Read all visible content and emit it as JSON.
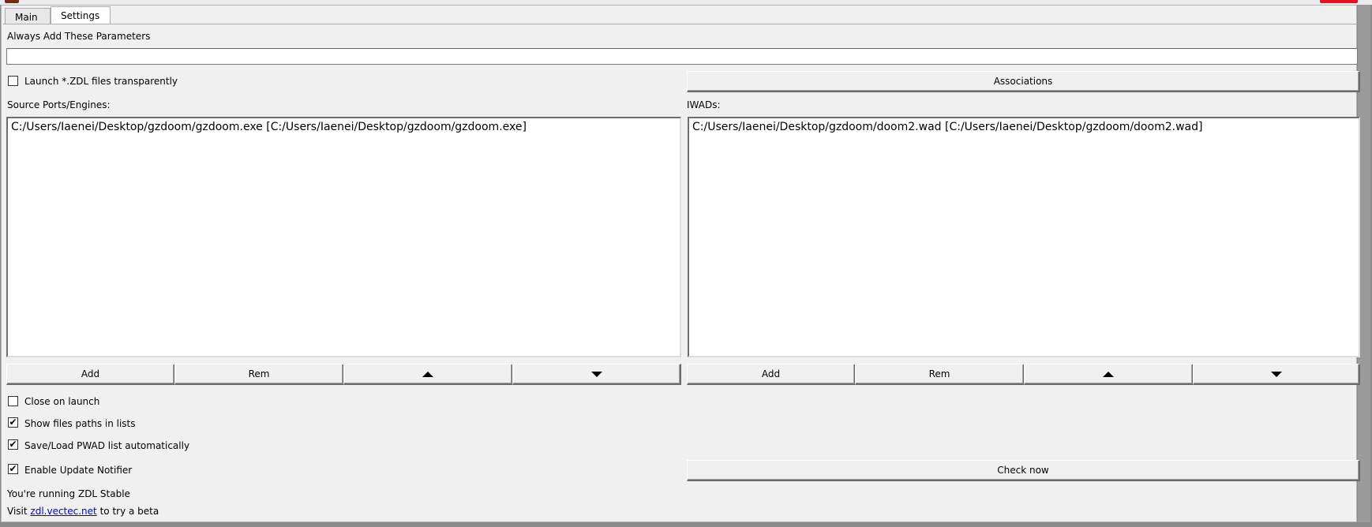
{
  "tabs": [
    {
      "label": "Main"
    },
    {
      "label": "Settings"
    }
  ],
  "settings": {
    "always_add_label": "Always Add These Parameters",
    "always_add_value": "",
    "launch_zdl_label": "Launch *.ZDL files transparently",
    "launch_zdl_checked": false,
    "associations_button": "Associations",
    "source_ports_label": "Source Ports/Engines:",
    "iwads_label": "IWADs:",
    "source_ports": [
      "C:/Users/Iaenei/Desktop/gzdoom/gzdoom.exe [C:/Users/Iaenei/Desktop/gzdoom/gzdoom.exe]"
    ],
    "iwads": [
      "C:/Users/Iaenei/Desktop/gzdoom/doom2.wad [C:/Users/Iaenei/Desktop/gzdoom/doom2.wad]"
    ],
    "add_label": "Add",
    "rem_label": "Rem",
    "up_icon": "triangle-up-icon",
    "down_icon": "triangle-down-icon",
    "close_on_launch_label": "Close on launch",
    "close_on_launch_checked": false,
    "show_paths_label": "Show files paths in lists",
    "show_paths_checked": true,
    "save_load_label": "Save/Load PWAD list automatically",
    "save_load_checked": true,
    "update_notifier_label": "Enable Update Notifier",
    "update_notifier_checked": true,
    "check_now_button": "Check now",
    "running_text": "You're running ZDL Stable",
    "visit_prefix": "Visit",
    "visit_link": "zdl.vectec.net",
    "visit_suffix": "to try a beta",
    "check_mark": "✔"
  },
  "colors": {
    "window_bg": "#f0f0f0",
    "close_button": "#e81123",
    "link": "#0000ee"
  }
}
